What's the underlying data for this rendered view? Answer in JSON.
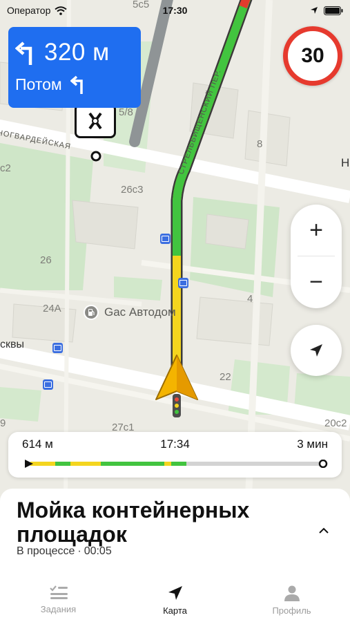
{
  "status_bar": {
    "carrier": "Оператор",
    "time": "17:30"
  },
  "maneuver": {
    "distance": "320 м",
    "then_label": "Потом"
  },
  "speed_limit": "30",
  "map": {
    "streets": {
      "left_street": "НОГВАРДЕЙСКАЯ",
      "route_street": "СТРЕЛЬБИЩЕНСКИЙ ПЕР.",
      "bottom_street": "сквы"
    },
    "labels": {
      "b5c5": "5с5",
      "b5_8": "5/8",
      "b8": "8",
      "b_c2": "с2",
      "b26c3": "26с3",
      "b26": "26",
      "b24a": "24А",
      "b4": "4",
      "b22": "22",
      "b9": "9",
      "b27c1": "27с1",
      "b20c2": "20с2",
      "b_n": "Н"
    },
    "poi": {
      "name": "Gас Автодом",
      "icon": "gas-station-icon"
    }
  },
  "zoom": {
    "in": "+",
    "out": "−"
  },
  "eta": {
    "distance": "614 м",
    "arrival": "17:34",
    "duration": "3 мин"
  },
  "task": {
    "title": "Мойка контейнерных площадок",
    "status": "В процессе",
    "separator": "·",
    "elapsed": "00:05"
  },
  "tabs": [
    {
      "label": "Задания",
      "icon": "tasks-icon",
      "active": false
    },
    {
      "label": "Карта",
      "icon": "navigation-arrow-icon",
      "active": true
    },
    {
      "label": "Профиль",
      "icon": "profile-icon",
      "active": false
    }
  ],
  "colors": {
    "accent": "#1f6ef0",
    "route_green": "#42c43f",
    "route_yellow": "#f4d51e",
    "speed_red": "#e63a2e"
  }
}
